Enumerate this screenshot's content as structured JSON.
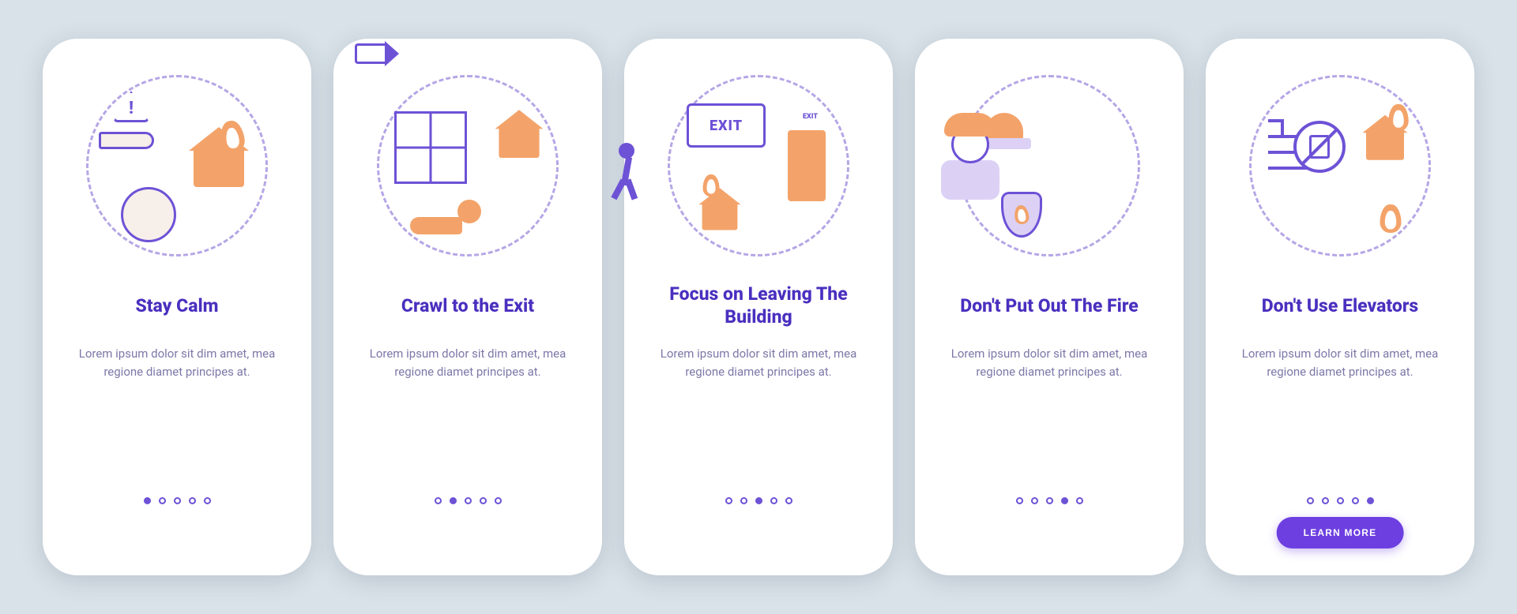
{
  "lorem": "Lorem ipsum dolor sit dim amet, mea regione diamet principes at.",
  "cta_label": "LEARN MORE",
  "total_slides": 5,
  "colors": {
    "primary": "#4a2fbf",
    "accent_orange": "#f3a36a",
    "accent_lilac": "#dcd1f5",
    "page_bg": "#d8e2e8"
  },
  "cards": [
    {
      "title": "Stay Calm",
      "active_index": 0,
      "show_cta": false,
      "icon": "calm"
    },
    {
      "title": "Crawl to the Exit",
      "active_index": 1,
      "show_cta": false,
      "icon": "crawl"
    },
    {
      "title": "Focus on Leaving The Building",
      "active_index": 2,
      "show_cta": false,
      "icon": "leave"
    },
    {
      "title": "Don't Put Out The Fire",
      "active_index": 3,
      "show_cta": false,
      "icon": "dont-put-out"
    },
    {
      "title": "Don't Use Elevators",
      "active_index": 4,
      "show_cta": true,
      "icon": "no-elevator"
    }
  ],
  "glyph_text": {
    "exit": "EXIT",
    "warn": "!"
  }
}
